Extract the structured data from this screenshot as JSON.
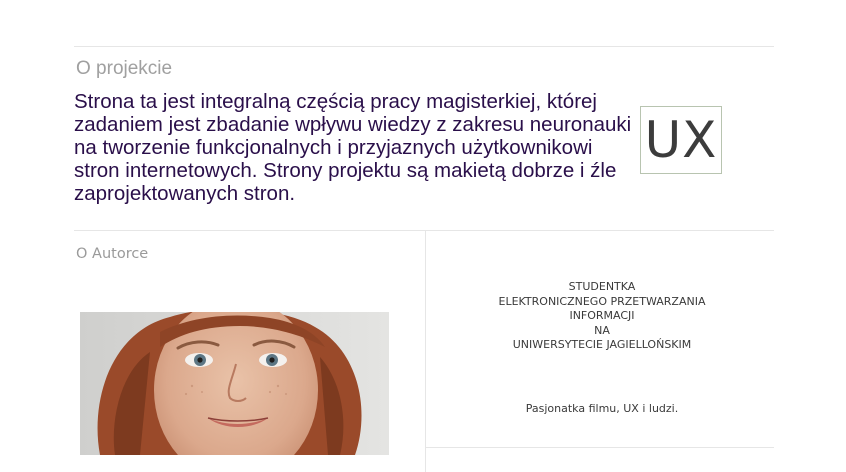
{
  "project": {
    "title": "O projekcie",
    "description": "Strona ta jest integralną częścią pracy magisterkiej, której zadaniem jest zbadanie wpływu wiedzy z zakresu neuronauki na tworzenie funkcjonalnych i przyjaznych użytkownikowi stron internetowych. Strony projektu są makietą dobrze i źle zaprojektowanych stron.",
    "logo_text": "UX"
  },
  "author": {
    "title": "O Autorce",
    "bio_lines": [
      "STUDENTKA",
      "ELEKTRONICZNEGO PRZETWARZANIA",
      "INFORMACJI",
      "NA",
      "UNIWERSYTECIE JAGIELLOŃSKIM"
    ],
    "tagline": "Pasjonatka filmu, UX i ludzi."
  },
  "colors": {
    "heading_text": "#2a0f4a",
    "muted_text": "#9a9a9a",
    "divider": "#e6e6e6",
    "logo_border": "#b8c4b0"
  }
}
